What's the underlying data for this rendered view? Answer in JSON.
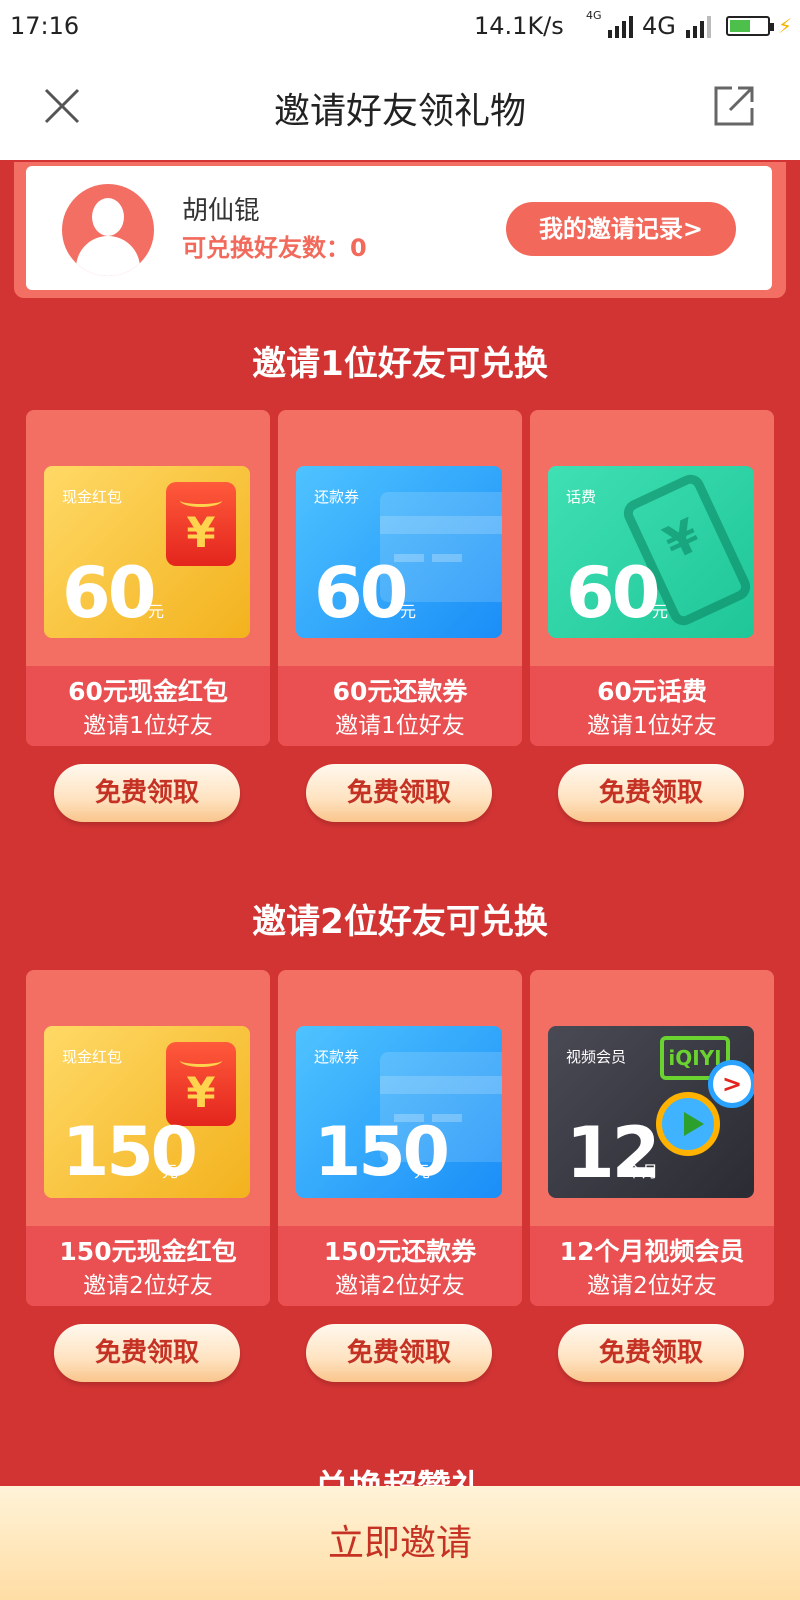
{
  "status_bar": {
    "time": "17:16",
    "speed": "14.1K/s",
    "network_small": "4G",
    "network": "4G",
    "battery_level": 0.55
  },
  "nav": {
    "title": "邀请好友领礼物"
  },
  "profile": {
    "name": "胡仙锟",
    "friend_count_label": "可兑换好友数：0",
    "record_button": "我的邀请记录>"
  },
  "sections": [
    {
      "title": "邀请1位好友可兑换",
      "items": [
        {
          "tile_label": "现金红包",
          "amount": "60",
          "unit": "元",
          "name": "60元现金红包",
          "subtitle": "邀请1位好友",
          "button": "免费领取"
        },
        {
          "tile_label": "还款券",
          "amount": "60",
          "unit": "元",
          "name": "60元还款券",
          "subtitle": "邀请1位好友",
          "button": "免费领取"
        },
        {
          "tile_label": "话费",
          "amount": "60",
          "unit": "元",
          "name": "60元话费",
          "subtitle": "邀请1位好友",
          "button": "免费领取"
        }
      ]
    },
    {
      "title": "邀请2位好友可兑换",
      "items": [
        {
          "tile_label": "现金红包",
          "amount": "150",
          "unit": "元",
          "name": "150元现金红包",
          "subtitle": "邀请2位好友",
          "button": "免费领取"
        },
        {
          "tile_label": "还款券",
          "amount": "150",
          "unit": "元",
          "name": "150元还款券",
          "subtitle": "邀请2位好友",
          "button": "免费领取"
        },
        {
          "tile_label": "视频会员",
          "amount": "12",
          "unit": "个月",
          "name": "12个月视频会员",
          "subtitle": "邀请2位好友",
          "button": "免费领取"
        }
      ]
    }
  ],
  "next_section_title": "兑换超赞礼",
  "icons": {
    "yen_glyph": "¥",
    "iqiyi_logo": "iQIYI",
    "play_arrow": ">"
  },
  "bottom": {
    "invite_button": "立即邀请"
  }
}
